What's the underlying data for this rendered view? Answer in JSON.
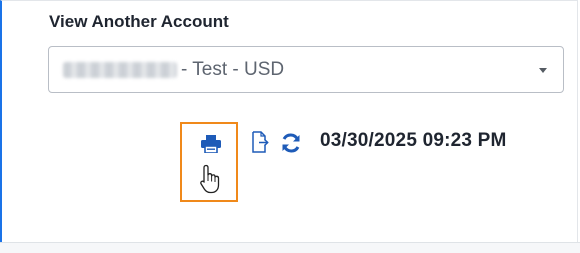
{
  "account_selector": {
    "label": "View Another Account",
    "selected_value": "- Test - USD",
    "masked_account_number": "redacted"
  },
  "toolbar": {
    "timestamp": "03/30/2025 09:23 PM",
    "icons": [
      "printer-icon",
      "export-file-icon",
      "refresh-icon",
      "hand-cursor-icon"
    ]
  },
  "colors": {
    "icon_blue": "#1e5bb8",
    "highlight_orange": "#f0891a",
    "accent_blue": "#1a73e8"
  }
}
